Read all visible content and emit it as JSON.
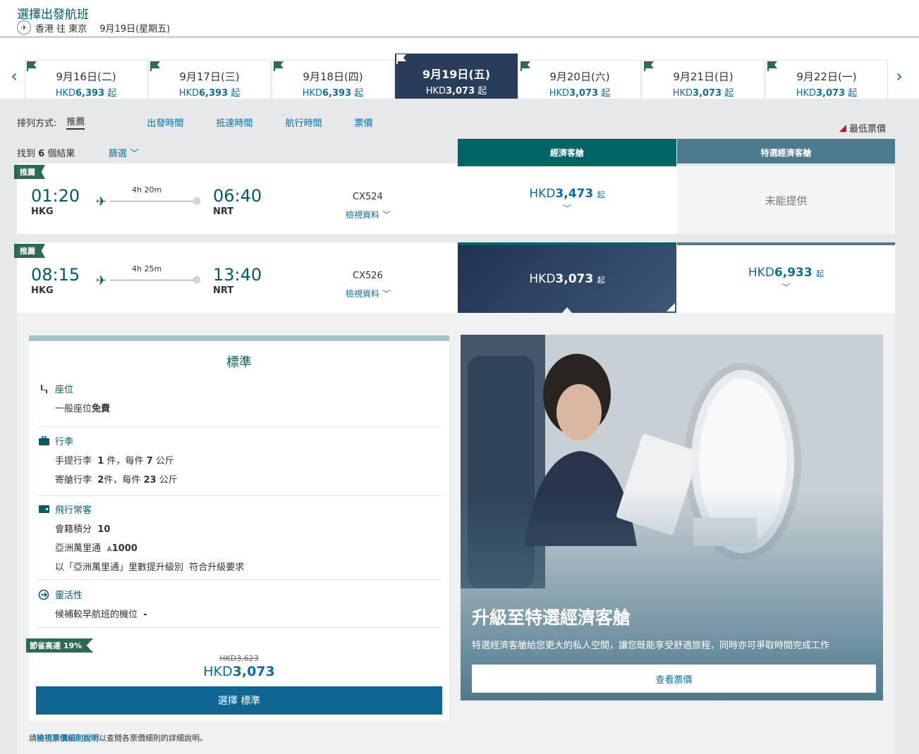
{
  "header": {
    "title": "選擇出發航班",
    "route": "香港 往 東京",
    "date": "9月19日(星期五)"
  },
  "date_tabs": [
    {
      "date": "9月16日(二)",
      "currency": "HKD",
      "price": "6,393",
      "suffix": "起",
      "selected": false
    },
    {
      "date": "9月17日(三)",
      "currency": "HKD",
      "price": "6,393",
      "suffix": "起",
      "selected": false
    },
    {
      "date": "9月18日(四)",
      "currency": "HKD",
      "price": "6,393",
      "suffix": "起",
      "selected": false
    },
    {
      "date": "9月19日(五)",
      "currency": "HKD",
      "price": "3,073",
      "suffix": "起",
      "selected": true
    },
    {
      "date": "9月20日(六)",
      "currency": "HKD",
      "price": "3,073",
      "suffix": "起",
      "selected": false
    },
    {
      "date": "9月21日(日)",
      "currency": "HKD",
      "price": "3,073",
      "suffix": "起",
      "selected": false
    },
    {
      "date": "9月22日(一)",
      "currency": "HKD",
      "price": "3,073",
      "suffix": "起",
      "selected": false
    }
  ],
  "sort": {
    "label": "排列方式:",
    "options": [
      "推薦",
      "出發時間",
      "抵達時間",
      "航行時間",
      "票價"
    ]
  },
  "lowest_fare": "最低票價",
  "results": {
    "prefix": "找到",
    "count": "6",
    "suffix": "個結果"
  },
  "filter": "篩選",
  "cabins": {
    "economy": "經濟客艙",
    "premium": "特選經濟客艙"
  },
  "flights": [
    {
      "badge": "推薦",
      "dep_time": "01:20",
      "dep_airport": "HKG",
      "duration": "4h 20m",
      "arr_time": "06:40",
      "arr_airport": "NRT",
      "flight_no": "CX524",
      "details": "檢視資料",
      "economy": {
        "currency": "HKD",
        "price": "3,473",
        "suffix": "起"
      },
      "premium_unavailable": "未能提供"
    },
    {
      "badge": "推薦",
      "dep_time": "08:15",
      "dep_airport": "HKG",
      "duration": "4h 25m",
      "arr_time": "13:40",
      "arr_airport": "NRT",
      "flight_no": "CX526",
      "details": "檢視資料",
      "economy": {
        "currency": "HKD",
        "price": "3,073",
        "suffix": "起"
      },
      "premium": {
        "currency": "HKD",
        "price": "6,933",
        "suffix": "起"
      }
    }
  ],
  "fare_card": {
    "title": "標準",
    "seat": {
      "title": "座位",
      "line_prefix": "一般座位",
      "line_bold": "免費"
    },
    "baggage": {
      "title": "行李",
      "carry_label": "手提行李",
      "carry_count": "1",
      "carry_mid": "件，每件",
      "carry_kg": "7",
      "carry_unit": "公斤",
      "checked_label": "寄艙行李",
      "checked_count": "2",
      "checked_mid": "件，每件",
      "checked_kg": "23",
      "checked_unit": "公斤"
    },
    "frequent": {
      "title": "飛行常客",
      "points_label": "會籍積分",
      "points": "10",
      "miles_label": "亞洲萬里通",
      "miles": "1000",
      "upgrade_label": "以「亞洲萬里通」里數提升級別",
      "upgrade_value": "符合升級要求"
    },
    "flex": {
      "title": "靈活性",
      "line": "候補較早航班的機位",
      "value": "-"
    },
    "save_badge": "節省高達 19%",
    "old_price": "HKD3,623",
    "new_currency": "HKD",
    "new_price": "3,073",
    "select_button": "選擇 標準"
  },
  "promo": {
    "title": "升級至特選經濟客艙",
    "desc": "特選經濟客艙給您更大的私人空間，讓您既能享受舒適旅程，同時亦可爭取時間完成工作",
    "button": "查看票價"
  },
  "footer": {
    "pre": "請",
    "link": "檢視票價細則說明",
    "post": "以查閱各票價細則的詳細說明。"
  },
  "colors": {
    "brand_green": "#005d63",
    "link_blue": "#0b6fa0",
    "selected_navy": "#283d5a",
    "economy_header": "#006564",
    "premium_header": "#4d7a8c",
    "badge_green": "#2d6a55"
  }
}
